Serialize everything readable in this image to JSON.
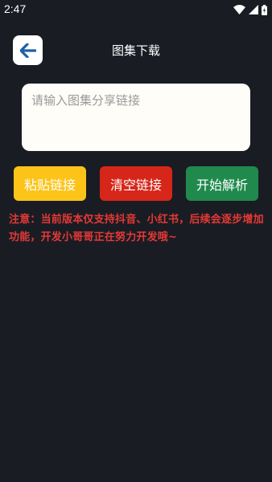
{
  "status_bar": {
    "time": "2:47"
  },
  "header": {
    "title": "图集下载",
    "back_icon": "arrow-left-icon"
  },
  "input": {
    "value": "",
    "placeholder": "请输入图集分享链接"
  },
  "buttons": {
    "paste": {
      "label": "粘贴链接",
      "color": "#fcc419"
    },
    "clear": {
      "label": "清空链接",
      "color": "#d6261a"
    },
    "parse": {
      "label": "开始解析",
      "color": "#1f8a4c"
    }
  },
  "notice": {
    "text": "注意：当前版本仅支持抖音、小红书，后续会逐步增加功能，开发小哥哥正在努力开发哦~",
    "color": "#e53935"
  },
  "colors": {
    "background": "#1a1c24",
    "accent": "#1f5fa8"
  }
}
